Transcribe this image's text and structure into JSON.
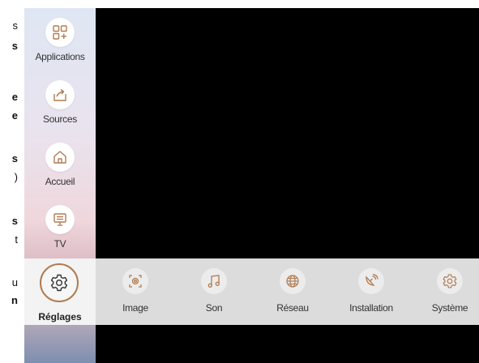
{
  "doc_fragments": [
    {
      "text": "s",
      "bold": false
    },
    {
      "text": "s",
      "bold": true
    },
    {
      "text": "e",
      "bold": true
    },
    {
      "text": "e",
      "bold": true
    },
    {
      "text": "s",
      "bold": true
    },
    {
      "text": ")",
      "bold": false
    },
    {
      "text": "s",
      "bold": true
    },
    {
      "text": "t",
      "bold": false
    },
    {
      "text": "u",
      "bold": false
    },
    {
      "text": "n",
      "bold": true
    }
  ],
  "sidebar": {
    "items": [
      {
        "label": "Applications",
        "icon": "apps-icon"
      },
      {
        "label": "Sources",
        "icon": "sources-icon"
      },
      {
        "label": "Accueil",
        "icon": "home-icon"
      },
      {
        "label": "TV",
        "icon": "tv-icon"
      }
    ]
  },
  "settings": {
    "main_label": "Réglages",
    "items": [
      {
        "label": "Image",
        "icon": "image-icon"
      },
      {
        "label": "Son",
        "icon": "music-note-icon"
      },
      {
        "label": "Réseau",
        "icon": "globe-icon"
      },
      {
        "label": "Installation",
        "icon": "satellite-icon"
      },
      {
        "label": "Système",
        "icon": "gear-icon"
      }
    ]
  },
  "colors": {
    "accent": "#b07c52",
    "screen": "#000000",
    "bar": "#dcdcdc"
  }
}
